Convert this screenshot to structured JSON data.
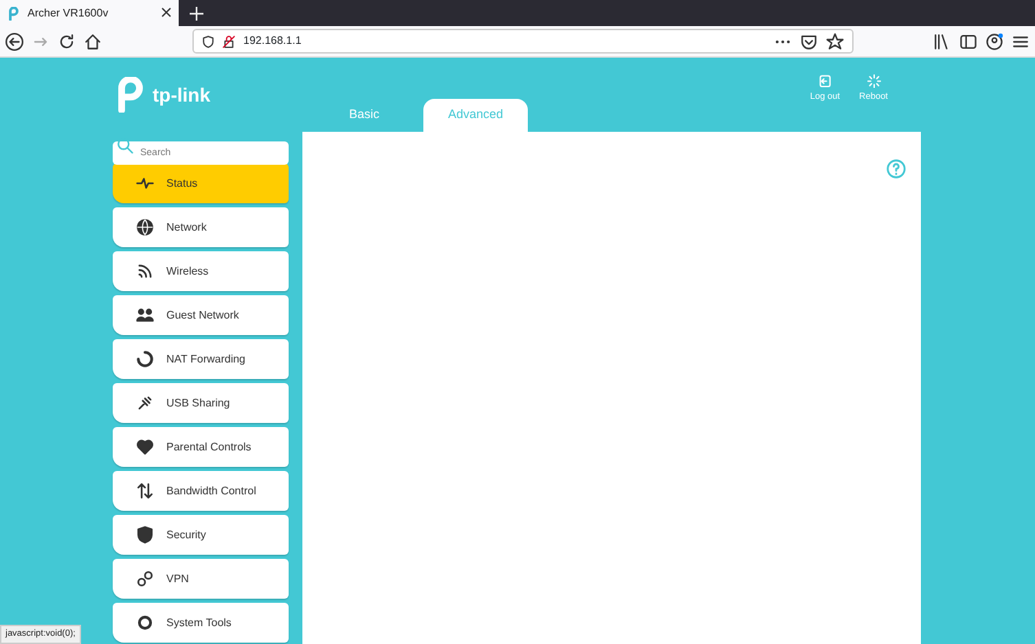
{
  "browser": {
    "tab": {
      "title": "Archer VR1600v",
      "selected": true
    },
    "url": "192.168.1.1"
  },
  "header": {
    "logo": "tp-link",
    "tabs": [
      {
        "label": "Basic",
        "selected": false
      },
      {
        "label": "Advanced",
        "selected": true
      }
    ],
    "actions": [
      {
        "kind": "logout",
        "label": "Log out"
      },
      {
        "kind": "reboot",
        "label": "Reboot"
      }
    ]
  },
  "sidebar": {
    "search": {
      "placeholder": "Search"
    },
    "items": [
      {
        "kind": "status",
        "label": "Status",
        "selected": true
      },
      {
        "kind": "network",
        "label": "Network",
        "selected": false
      },
      {
        "kind": "wireless",
        "label": "Wireless",
        "selected": false
      },
      {
        "kind": "guest",
        "label": "Guest Network",
        "selected": false
      },
      {
        "kind": "nat",
        "label": "NAT Forwarding",
        "selected": false
      },
      {
        "kind": "usb",
        "label": "USB Sharing",
        "selected": false
      },
      {
        "kind": "parental",
        "label": "Parental Controls",
        "selected": false
      },
      {
        "kind": "bandwidth",
        "label": "Bandwidth Control",
        "selected": false
      },
      {
        "kind": "security",
        "label": "Security",
        "selected": false
      },
      {
        "kind": "vpn",
        "label": "VPN",
        "selected": false
      },
      {
        "kind": "tools",
        "label": "System Tools",
        "selected": false
      }
    ]
  },
  "status_bar": "javascript:void(0);"
}
